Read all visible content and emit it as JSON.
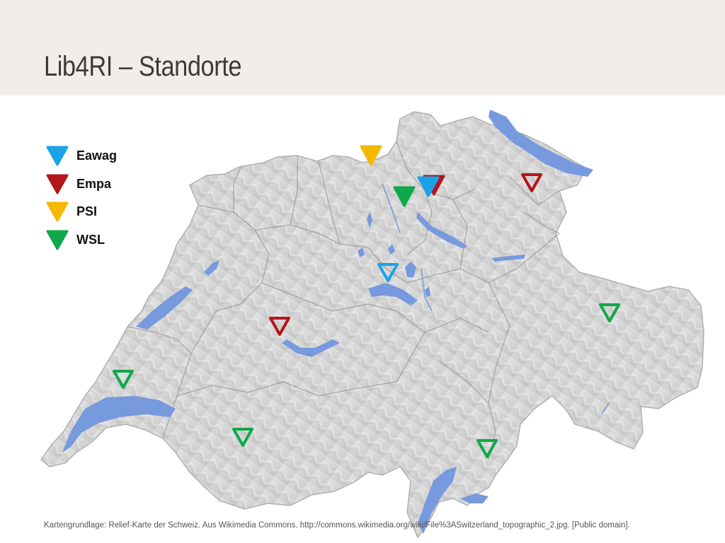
{
  "slide": {
    "title": "Lib4RI – Standorte",
    "caption": "Kartengrundlage: Relief-Karte der Schweiz. Aus Wikimedia Commons. http://commons.wikimedia.org/wiki/File%3ASwitzerland_topographic_2.jpg. [Public domain]."
  },
  "legend": [
    {
      "label": "Eawag",
      "color": "#1aa3e8",
      "style": "filled"
    },
    {
      "label": "Empa",
      "color": "#b5151b",
      "style": "filled"
    },
    {
      "label": "PSI",
      "color": "#f5b800",
      "style": "filled"
    },
    {
      "label": "WSL",
      "color": "#10a84a",
      "style": "filled"
    }
  ],
  "map": {
    "base": "relief map of Switzerland",
    "colors": {
      "land": "#d9d9d9",
      "lakes": "#7799dd",
      "borders": "#8a8a8a",
      "background": "#ffffff"
    },
    "markers": [
      {
        "institute": "PSI",
        "style": "filled",
        "color": "#f5b800"
      },
      {
        "institute": "WSL",
        "style": "filled",
        "color": "#10a84a"
      },
      {
        "institute": "Eawag",
        "style": "filled",
        "color": "#1aa3e8"
      },
      {
        "institute": "Empa",
        "style": "filled",
        "color": "#b5151b"
      },
      {
        "institute": "Empa",
        "style": "outline",
        "color": "#b5151b"
      },
      {
        "institute": "Eawag",
        "style": "outline",
        "color": "#1aa3e8"
      },
      {
        "institute": "Empa",
        "style": "outline",
        "color": "#b5151b"
      },
      {
        "institute": "WSL",
        "style": "outline",
        "color": "#10a84a"
      },
      {
        "institute": "WSL",
        "style": "outline",
        "color": "#10a84a"
      },
      {
        "institute": "WSL",
        "style": "outline",
        "color": "#10a84a"
      },
      {
        "institute": "WSL",
        "style": "outline",
        "color": "#10a84a"
      }
    ]
  }
}
